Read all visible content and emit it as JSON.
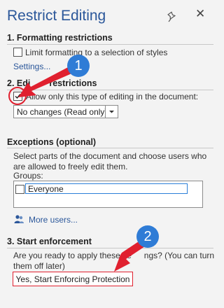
{
  "pane": {
    "title": "Restrict Editing",
    "pin_icon": "pin-icon",
    "close_icon": "close-icon"
  },
  "section1": {
    "title": "1. Formatting restrictions",
    "checkbox_label": "Limit formatting to a selection of styles",
    "checkbox_checked": false,
    "settings_link": "Settings..."
  },
  "section2": {
    "title_visible": "2. Edi",
    "title_tail": "restrictions",
    "checkbox_label": "Allow only this type of editing in the document:",
    "checkbox_checked": true,
    "select_value": "No changes (Read only)"
  },
  "exceptions": {
    "title": "Exceptions (optional)",
    "description": "Select parts of the document and choose users who are allowed to freely edit them.",
    "groups_label": "Groups:",
    "groups": [
      {
        "name": "Everyone",
        "checked": false
      }
    ],
    "more_users_link": "More users..."
  },
  "section3": {
    "title": "3. Start enforcement",
    "description_part1": "Are you ready to apply these se",
    "description_part2": "ngs? (You can turn",
    "description_line2": "them off later)",
    "button_label": "Yes, Start Enforcing Protection"
  },
  "annotations": {
    "badge1": "1",
    "badge2": "2",
    "accent_color": "#e0202f",
    "badge_color": "#2f7cd6"
  },
  "colors": {
    "background": "#f3f3f3",
    "title": "#2b579a",
    "link": "#2b579a"
  }
}
